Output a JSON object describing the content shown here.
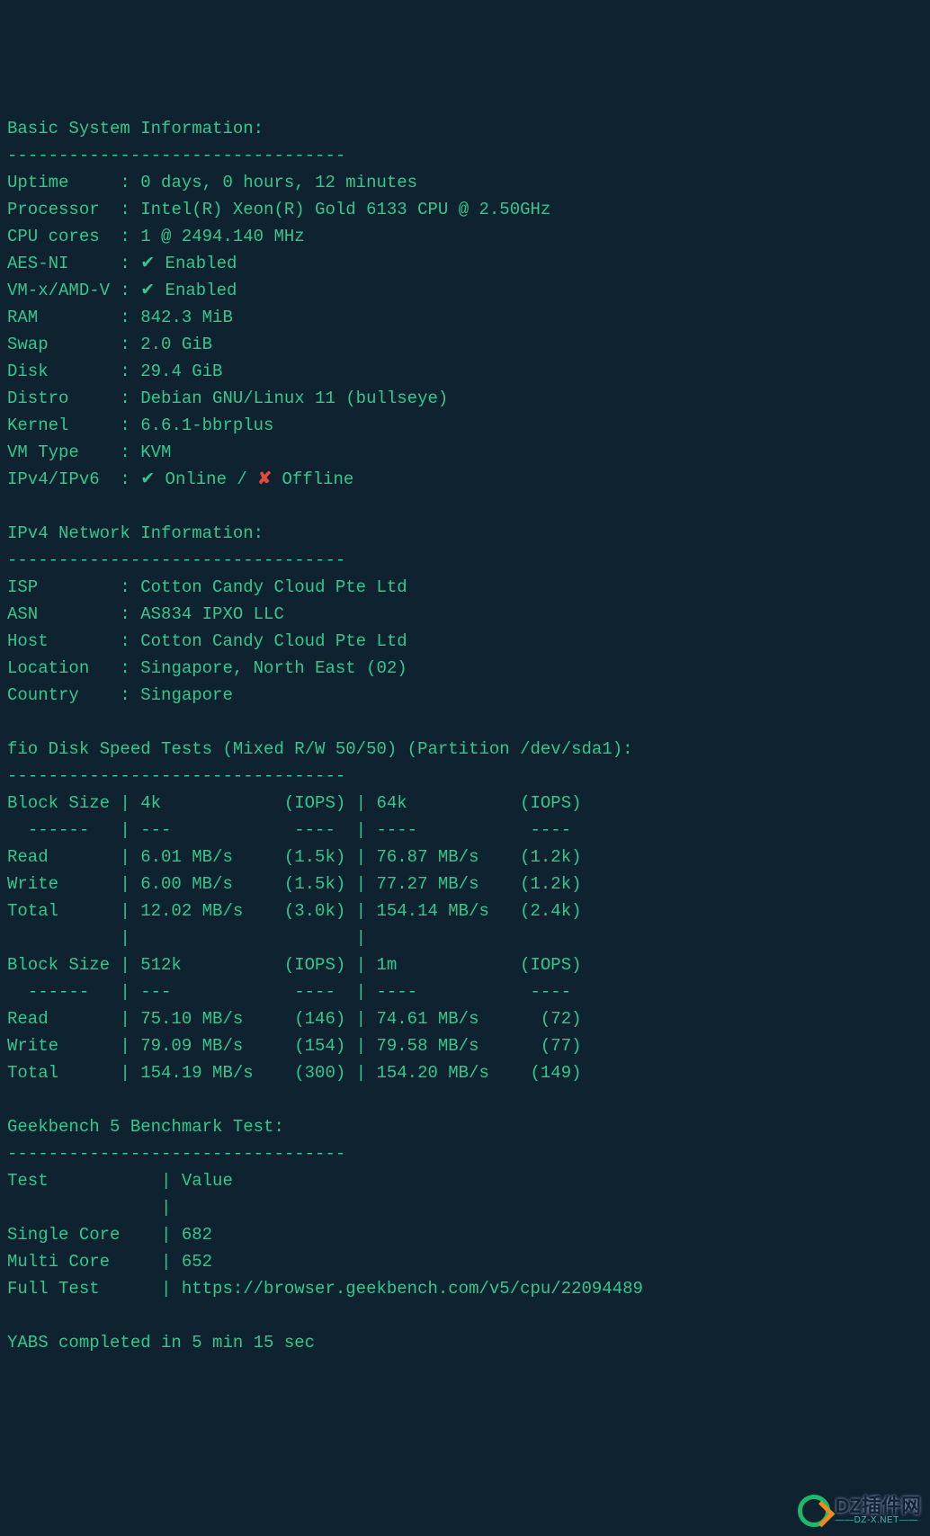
{
  "sections": {
    "sys": {
      "title": "Basic System Information:",
      "rule": "---------------------------------",
      "rows": [
        {
          "label": "Uptime     ",
          "value": "0 days, 0 hours, 12 minutes"
        },
        {
          "label": "Processor  ",
          "value": "Intel(R) Xeon(R) Gold 6133 CPU @ 2.50GHz"
        },
        {
          "label": "CPU cores  ",
          "value": "1 @ 2494.140 MHz"
        },
        {
          "label": "AES-NI     ",
          "value": "✔ Enabled"
        },
        {
          "label": "VM-x/AMD-V ",
          "value": "✔ Enabled"
        },
        {
          "label": "RAM        ",
          "value": "842.3 MiB"
        },
        {
          "label": "Swap       ",
          "value": "2.0 GiB"
        },
        {
          "label": "Disk       ",
          "value": "29.4 GiB"
        },
        {
          "label": "Distro     ",
          "value": "Debian GNU/Linux 11 (bullseye)"
        },
        {
          "label": "Kernel     ",
          "value": "6.6.1-bbrplus"
        },
        {
          "label": "VM Type    ",
          "value": "KVM"
        }
      ],
      "ip_label": "IPv4/IPv6  ",
      "ip_online": "✔ Online / ",
      "ip_cross": "✘",
      "ip_offline": " Offline"
    },
    "net": {
      "title": "IPv4 Network Information:",
      "rule": "---------------------------------",
      "rows": [
        {
          "label": "ISP        ",
          "value": "Cotton Candy Cloud Pte Ltd"
        },
        {
          "label": "ASN        ",
          "value": "AS834 IPXO LLC"
        },
        {
          "label": "Host       ",
          "value": "Cotton Candy Cloud Pte Ltd"
        },
        {
          "label": "Location   ",
          "value": "Singapore, North East (02)"
        },
        {
          "label": "Country    ",
          "value": "Singapore"
        }
      ]
    },
    "fio": {
      "title": "fio Disk Speed Tests (Mixed R/W 50/50) (Partition /dev/sda1):",
      "rule": "---------------------------------",
      "block1": {
        "header": "Block Size | 4k            (IOPS) | 64k           (IOPS)",
        "sep": "  ------   | ---            ----  | ----           ---- ",
        "rows": [
          "Read       | 6.01 MB/s     (1.5k) | 76.87 MB/s    (1.2k)",
          "Write      | 6.00 MB/s     (1.5k) | 77.27 MB/s    (1.2k)",
          "Total      | 12.02 MB/s    (3.0k) | 154.14 MB/s   (2.4k)"
        ],
        "blank": "           |                      |                     "
      },
      "block2": {
        "header": "Block Size | 512k          (IOPS) | 1m            (IOPS)",
        "sep": "  ------   | ---            ----  | ----           ---- ",
        "rows": [
          "Read       | 75.10 MB/s     (146) | 74.61 MB/s      (72)",
          "Write      | 79.09 MB/s     (154) | 79.58 MB/s      (77)",
          "Total      | 154.19 MB/s    (300) | 154.20 MB/s    (149)"
        ]
      }
    },
    "geek": {
      "title": "Geekbench 5 Benchmark Test:",
      "rule": "---------------------------------",
      "header": "Test           | Value",
      "blank": "               | ",
      "rows": [
        "Single Core    | 682",
        "Multi Core     | 652",
        "Full Test      | https://browser.geekbench.com/v5/cpu/22094489"
      ]
    },
    "footer": "YABS completed in 5 min 15 sec"
  },
  "watermark": {
    "big": "DZ插件网",
    "small": "——DZ-X.NET——"
  },
  "chart_data": {
    "type": "table",
    "title": "fio Disk Speed Tests (Mixed R/W 50/50)",
    "partition": "/dev/sda1",
    "blocks": [
      {
        "block_size": "4k",
        "read": {
          "speed_mb_s": 6.01,
          "iops": "1.5k"
        },
        "write": {
          "speed_mb_s": 6.0,
          "iops": "1.5k"
        },
        "total": {
          "speed_mb_s": 12.02,
          "iops": "3.0k"
        }
      },
      {
        "block_size": "64k",
        "read": {
          "speed_mb_s": 76.87,
          "iops": "1.2k"
        },
        "write": {
          "speed_mb_s": 77.27,
          "iops": "1.2k"
        },
        "total": {
          "speed_mb_s": 154.14,
          "iops": "2.4k"
        }
      },
      {
        "block_size": "512k",
        "read": {
          "speed_mb_s": 75.1,
          "iops": 146
        },
        "write": {
          "speed_mb_s": 79.09,
          "iops": 154
        },
        "total": {
          "speed_mb_s": 154.19,
          "iops": 300
        }
      },
      {
        "block_size": "1m",
        "read": {
          "speed_mb_s": 74.61,
          "iops": 72
        },
        "write": {
          "speed_mb_s": 79.58,
          "iops": 77
        },
        "total": {
          "speed_mb_s": 154.2,
          "iops": 149
        }
      }
    ],
    "geekbench5": {
      "single_core": 682,
      "multi_core": 652,
      "url": "https://browser.geekbench.com/v5/cpu/22094489"
    }
  }
}
